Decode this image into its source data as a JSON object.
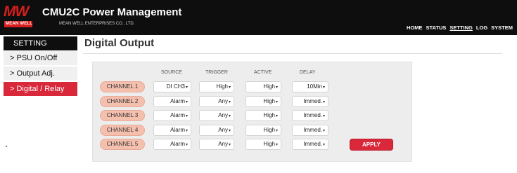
{
  "header": {
    "logo_text": "MW",
    "logo_subtext": "MEAN WELL",
    "title": "CMU2C Power Management",
    "subtitle": "MEAN WELL ENTERPRISES CO., LTD.",
    "nav": [
      "HOME",
      "STATUS",
      "SETTING",
      "LOG",
      "SYSTEM"
    ],
    "active_nav": "SETTING"
  },
  "sidebar": {
    "heading": "SETTING",
    "items": [
      {
        "label": "> PSU On/Off",
        "active": false
      },
      {
        "label": "> Output Adj.",
        "active": false
      },
      {
        "label": "> Digital / Relay",
        "active": true
      }
    ]
  },
  "main": {
    "title": "Digital Output",
    "columns": [
      "SOURCE",
      "TRIGGER",
      "ACTIVE",
      "DELAY"
    ],
    "rows": [
      {
        "channel": "CHANNEL 1",
        "source": "DI CH3",
        "trigger": "High",
        "active": "High",
        "delay": "10Min"
      },
      {
        "channel": "CHANNEL 2",
        "source": "Alarm",
        "trigger": "Any",
        "active": "High",
        "delay": "Immed."
      },
      {
        "channel": "CHANNEL 3",
        "source": "Alarm",
        "trigger": "Any",
        "active": "High",
        "delay": "Immed."
      },
      {
        "channel": "CHANNEL 4",
        "source": "Alarm",
        "trigger": "Any",
        "active": "High",
        "delay": "Immed."
      },
      {
        "channel": "CHANNEL 5",
        "source": "Alarm",
        "trigger": "Any",
        "active": "High",
        "delay": "Immed."
      }
    ],
    "apply_label": "APPLY"
  },
  "colors": {
    "header_bg": "#0e0e0e",
    "brand_red": "#d81e1e",
    "accent_red": "#d9283a",
    "channel_pill": "#f5bfae",
    "panel_bg": "#ededed"
  }
}
